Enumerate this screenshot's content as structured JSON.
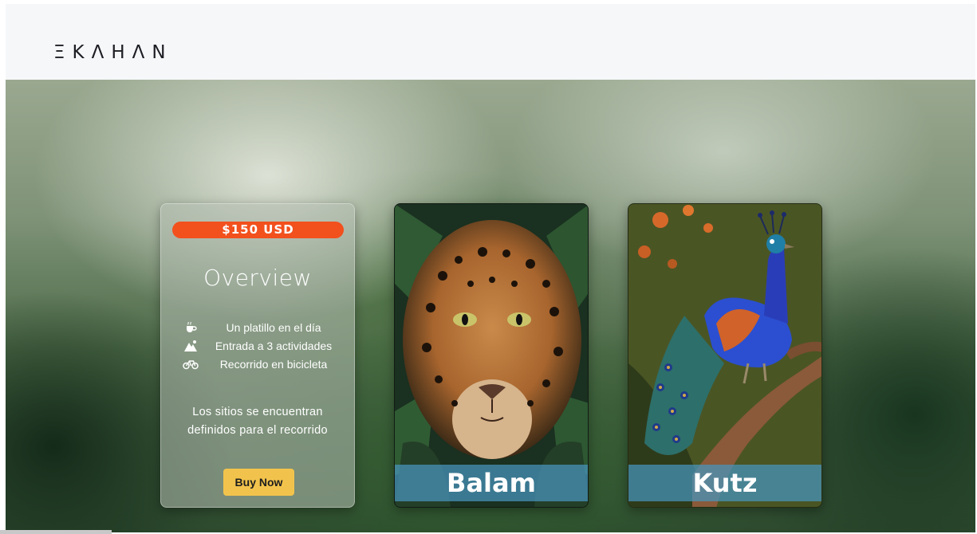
{
  "header": {
    "logo_text": "ΞKΛHΛN",
    "logo_icon": "bird-mark-icon"
  },
  "hero": {
    "ghost_heading": ""
  },
  "overview_card": {
    "price": "$150 USD",
    "title": "Overview",
    "features": [
      {
        "icon": "cup-icon",
        "text": "Un platillo en el día"
      },
      {
        "icon": "mountain-icon",
        "text": "Entrada a 3 actividades"
      },
      {
        "icon": "bicycle-icon",
        "text": "Recorrido en bicicleta"
      }
    ],
    "description_line1": "Los sitios se encuentran",
    "description_line2": "definidos para el recorrido",
    "buy_label": "Buy Now"
  },
  "cards": [
    {
      "name": "Balam",
      "image": "jaguar"
    },
    {
      "name": "Kutz",
      "image": "peacock"
    }
  ],
  "colors": {
    "price_pill": "#f2501d",
    "buy_button": "#f2c34c",
    "name_band": "#4896be"
  }
}
